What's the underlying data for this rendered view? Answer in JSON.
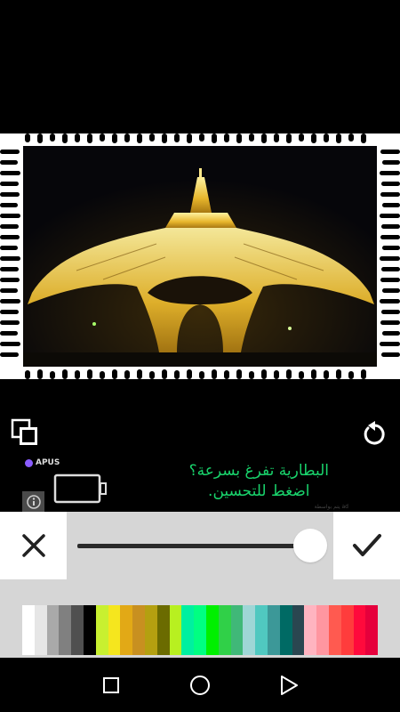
{
  "photo": {
    "subject": "Eiffel Tower at night"
  },
  "toolbar": {
    "layers_icon": "layers-icon",
    "reset_icon": "rotate-ccw-icon"
  },
  "ad": {
    "brand": "APUS",
    "line1": "البطارية تفرغ بسرعة؟",
    "line2": "اضغط للتحسين.",
    "text_color": "#19d46c",
    "watermark": "يتم بواسطة ad"
  },
  "slider": {
    "value_percent": 100
  },
  "controls": {
    "cancel_icon": "close-icon",
    "confirm_icon": "check-icon"
  },
  "palette": {
    "colors": [
      "#ffffff",
      "#e6e6e6",
      "#a9a9a9",
      "#808080",
      "#505050",
      "#000000",
      "#c8f030",
      "#f5e61e",
      "#e2a916",
      "#c89020",
      "#b4a010",
      "#6b6b00",
      "#b8f020",
      "#00f0a0",
      "#00ff82",
      "#00f000",
      "#30d048",
      "#40b878",
      "#9fd6d6",
      "#50c8c0",
      "#3c9898",
      "#006a64",
      "#2a4650",
      "#ffb4c0",
      "#ff96a0",
      "#ff5a50",
      "#ff3c3c",
      "#ff0a3c",
      "#e6003c"
    ]
  },
  "nav": {
    "recents_icon": "square-icon",
    "home_icon": "circle-icon",
    "back_icon": "triangle-icon"
  }
}
